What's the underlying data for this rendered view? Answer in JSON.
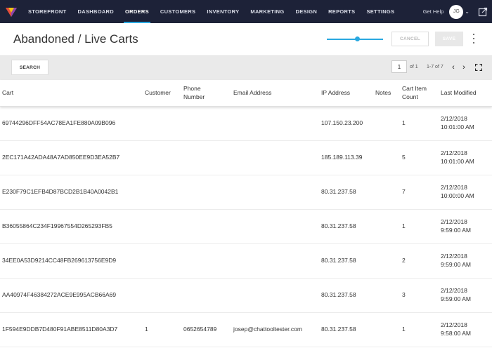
{
  "nav": {
    "items": [
      {
        "label": "STOREFRONT",
        "active": false
      },
      {
        "label": "DASHBOARD",
        "active": false
      },
      {
        "label": "ORDERS",
        "active": true
      },
      {
        "label": "CUSTOMERS",
        "active": false
      },
      {
        "label": "INVENTORY",
        "active": false
      },
      {
        "label": "MARKETING",
        "active": false
      },
      {
        "label": "DESIGN",
        "active": false
      },
      {
        "label": "REPORTS",
        "active": false
      },
      {
        "label": "SETTINGS",
        "active": false
      }
    ],
    "get_help": "Get Help",
    "avatar_initials": "JG",
    "accent_color": "#29a8e0",
    "bar_color": "#1d2238"
  },
  "header": {
    "title": "Abandoned / Live Carts",
    "cancel_label": "CANCEL",
    "save_label": "SAVE"
  },
  "toolbar": {
    "search_label": "SEARCH",
    "page_value": "1",
    "page_of": "of 1",
    "range": "1-7 of 7"
  },
  "table": {
    "columns": {
      "cart": "Cart",
      "customer": "Customer",
      "phone_1": "Phone",
      "phone_2": "Number",
      "email": "Email Address",
      "ip": "IP Address",
      "notes": "Notes",
      "count_1": "Cart Item",
      "count_2": "Count",
      "modified": "Last Modified"
    },
    "rows": [
      {
        "cart": "69744296DFF54AC78EA1FE880A09B096",
        "customer": "",
        "phone": "",
        "email": "",
        "ip": "107.150.23.200",
        "notes": "",
        "count": "1",
        "date": "2/12/2018",
        "time": "10:01:00 AM"
      },
      {
        "cart": "2EC171A42ADA48A7AD850EE9D3EA52B7",
        "customer": "",
        "phone": "",
        "email": "",
        "ip": "185.189.113.39",
        "notes": "",
        "count": "5",
        "date": "2/12/2018",
        "time": "10:01:00 AM"
      },
      {
        "cart": "E230F79C1EFB4D87BCD2B1B40A0042B1",
        "customer": "",
        "phone": "",
        "email": "",
        "ip": "80.31.237.58",
        "notes": "",
        "count": "7",
        "date": "2/12/2018",
        "time": "10:00:00 AM"
      },
      {
        "cart": "B36055864C234F19967554D265293FB5",
        "customer": "",
        "phone": "",
        "email": "",
        "ip": "80.31.237.58",
        "notes": "",
        "count": "1",
        "date": "2/12/2018",
        "time": "9:59:00 AM"
      },
      {
        "cart": "34EE0A53D9214CC48FB269613756E9D9",
        "customer": "",
        "phone": "",
        "email": "",
        "ip": "80.31.237.58",
        "notes": "",
        "count": "2",
        "date": "2/12/2018",
        "time": "9:59:00 AM"
      },
      {
        "cart": "AA40974F46384272ACE9E995ACB66A69",
        "customer": "",
        "phone": "",
        "email": "",
        "ip": "80.31.237.58",
        "notes": "",
        "count": "3",
        "date": "2/12/2018",
        "time": "9:59:00 AM"
      },
      {
        "cart": "1F594E9DDB7D480F91ABE8511D80A3D7",
        "customer": "1",
        "phone": "0652654789",
        "email": "josep@chattooltester.com",
        "ip": "80.31.237.58",
        "notes": "",
        "count": "1",
        "date": "2/12/2018",
        "time": "9:58:00 AM"
      }
    ]
  }
}
